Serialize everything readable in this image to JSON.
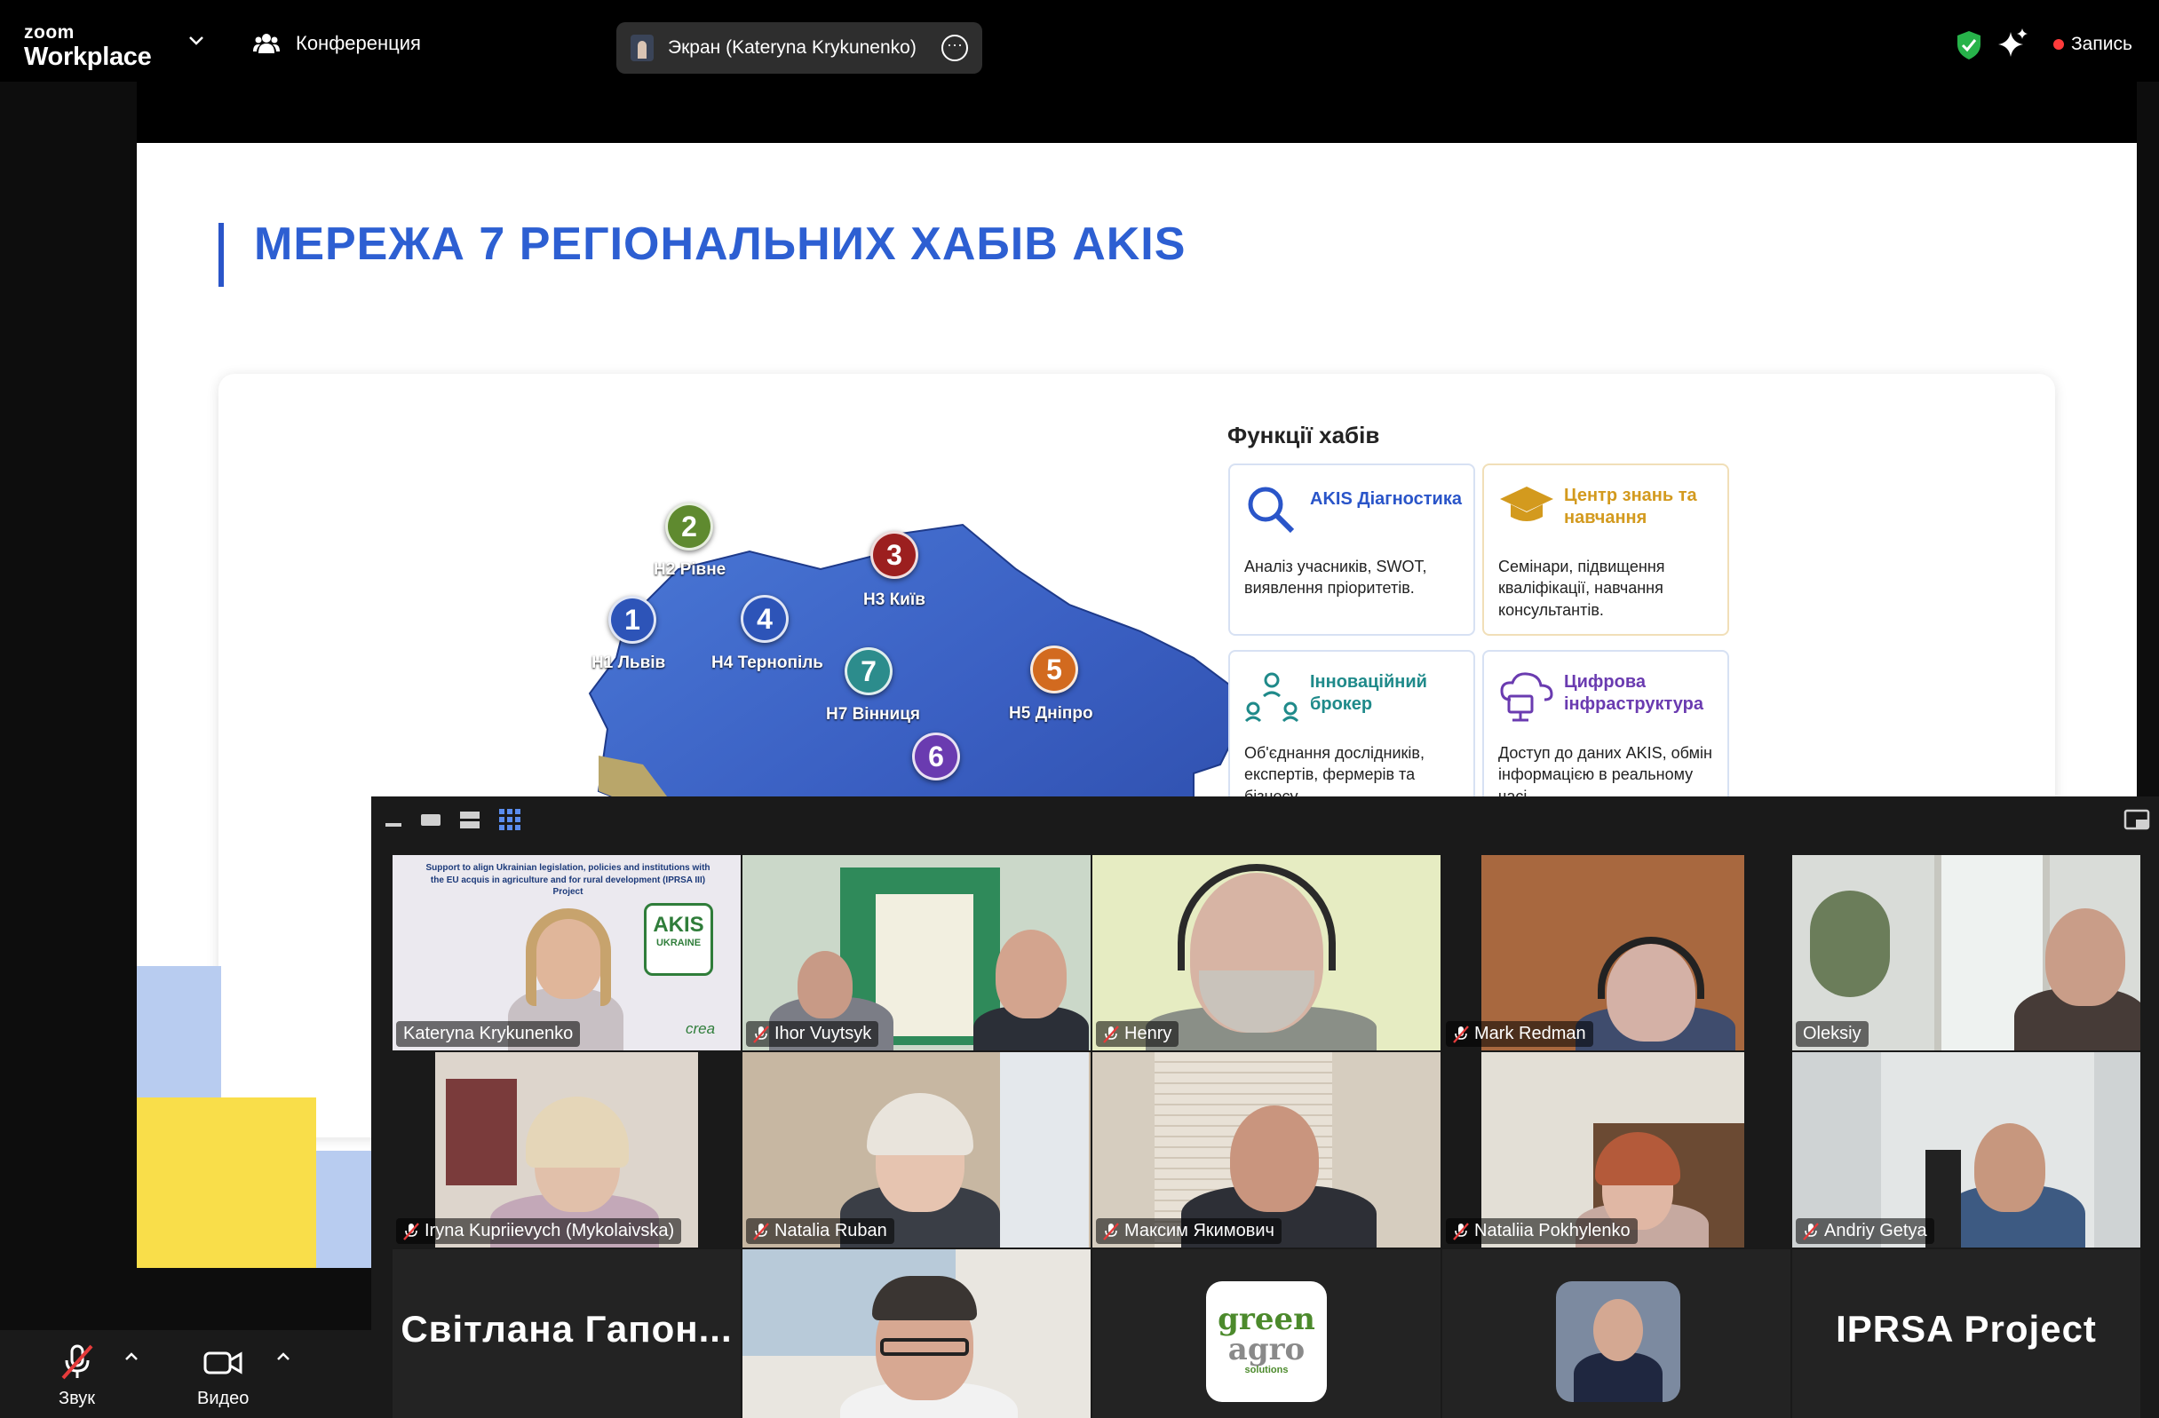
{
  "topbar": {
    "logo_line1": "zoom",
    "logo_line2": "Workplace",
    "meeting_label": "Конференция",
    "share_label": "Экран (Kateryna Krykunenko)",
    "record_label": "Запись"
  },
  "slide": {
    "title": "МЕРЕЖА 7 РЕГІОНАЛЬНИХ ХАБІВ AKIS",
    "functions_heading": "Функції хабів",
    "hubs": [
      {
        "num": "1",
        "label": "H1 Львів",
        "color": "#2d54b8"
      },
      {
        "num": "2",
        "label": "H2 Рівне",
        "color": "#5f8a2f"
      },
      {
        "num": "3",
        "label": "H3 Київ",
        "color": "#9c1f1f"
      },
      {
        "num": "4",
        "label": "H4 Тернопіль",
        "color": "#2d54b8"
      },
      {
        "num": "5",
        "label": "H5 Дніпро",
        "color": "#d26a1f"
      },
      {
        "num": "6",
        "label": "",
        "color": "#6a3bb0"
      },
      {
        "num": "7",
        "label": "H7 Вінниця",
        "color": "#2c8c8c"
      }
    ],
    "functions": [
      {
        "title": "AKIS Діагностика",
        "desc": "Аналіз учасників, SWOT, виявлення пріоритетів.",
        "title_color": "#2a55c9"
      },
      {
        "title": "Центр знань та навчання",
        "desc": "Семінари, підвищення кваліфікації, навчання консультантів.",
        "title_color": "#d39a1e"
      },
      {
        "title": "Інноваційний брокер",
        "desc": "Об'єднання дослідників, експертів, фермерів та бізнесу",
        "title_color": "#1f8a8a"
      },
      {
        "title": "Цифрова інфраструктура",
        "desc": "Доступ до даних AKIS, обмін інформацією в реальному часі",
        "title_color": "#6a3bb0"
      }
    ]
  },
  "gallery": {
    "participants": [
      {
        "name": "Kateryna Krykunenko",
        "muted": false,
        "active": true
      },
      {
        "name": "Ihor Vuytsyk",
        "muted": true
      },
      {
        "name": "Henry",
        "muted": true
      },
      {
        "name": "Mark Redman",
        "muted": true
      },
      {
        "name": "Oleksiy",
        "muted": false
      },
      {
        "name": "Iryna Kupriievych (Mykolaivska)",
        "muted": true
      },
      {
        "name": "Natalia Ruban",
        "muted": true
      },
      {
        "name": "Максим Якимович",
        "muted": true
      },
      {
        "name": "Nataliia Pokhylenko",
        "muted": true
      },
      {
        "name": "Andriy Getya",
        "muted": true
      },
      {
        "name": "Світлана Гапон...",
        "muted": true
      },
      {
        "name": "",
        "muted": true
      },
      {
        "name": "",
        "muted": true
      },
      {
        "name": "",
        "muted": true
      },
      {
        "name": "IPRSA Project",
        "muted": true
      }
    ],
    "kateryna_banner_line1": "Support to align Ukrainian legislation, policies and institutions with",
    "kateryna_banner_line2": "the EU acquis in agriculture and for rural development (IPRSA III) Project",
    "akis_logo_line1": "AKIS",
    "akis_logo_line2": "UKRAINE",
    "crea_label": "crea",
    "greenagro_line1": "green",
    "greenagro_line2": "agro",
    "greenagro_line3": "solutions"
  },
  "toolbar": {
    "audio_label": "Звук",
    "video_label": "Видео"
  },
  "icons": {
    "shield": "shield-check-icon",
    "sparkle": "ai-sparkle-icon",
    "mic_off": "mic-off-icon",
    "camera": "video-camera-icon"
  }
}
